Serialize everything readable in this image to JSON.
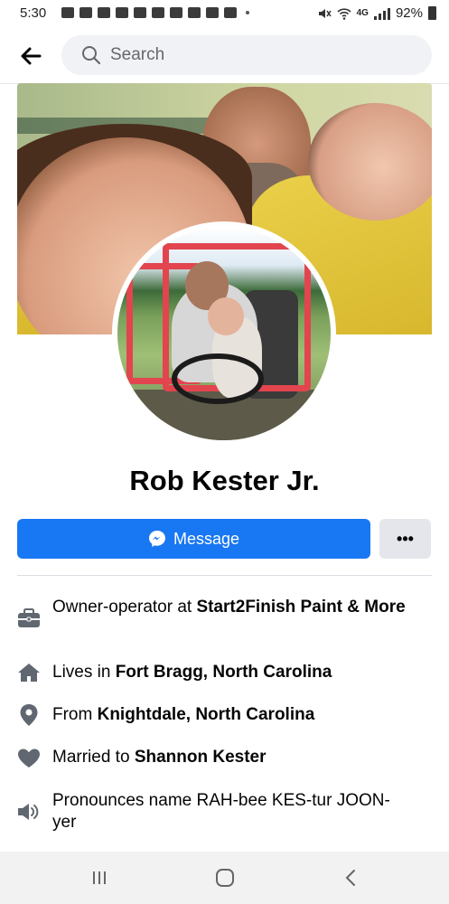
{
  "status_bar": {
    "time": "5:30",
    "battery": "92%",
    "network": "4G"
  },
  "search": {
    "placeholder": "Search"
  },
  "profile": {
    "name": "Rob Kester Jr.",
    "message_button": "Message",
    "more_button": "•••"
  },
  "details": [
    {
      "icon": "briefcase-icon",
      "prefix": "Owner-operator at ",
      "bold": "Start2Finish Paint & More"
    },
    {
      "icon": "home-icon",
      "prefix": "Lives in ",
      "bold": "Fort Bragg, North Carolina"
    },
    {
      "icon": "location-pin-icon",
      "prefix": "From ",
      "bold": "Knightdale, North Carolina"
    },
    {
      "icon": "heart-icon",
      "prefix": "Married to ",
      "bold": "Shannon Kester"
    },
    {
      "icon": "speaker-icon",
      "prefix": "Pronounces name RAH-bee KES-tur JOON-yer",
      "bold": ""
    }
  ],
  "colors": {
    "accent": "#1877f2",
    "secondary_button": "#e4e6eb",
    "icon_gray": "#606770"
  }
}
